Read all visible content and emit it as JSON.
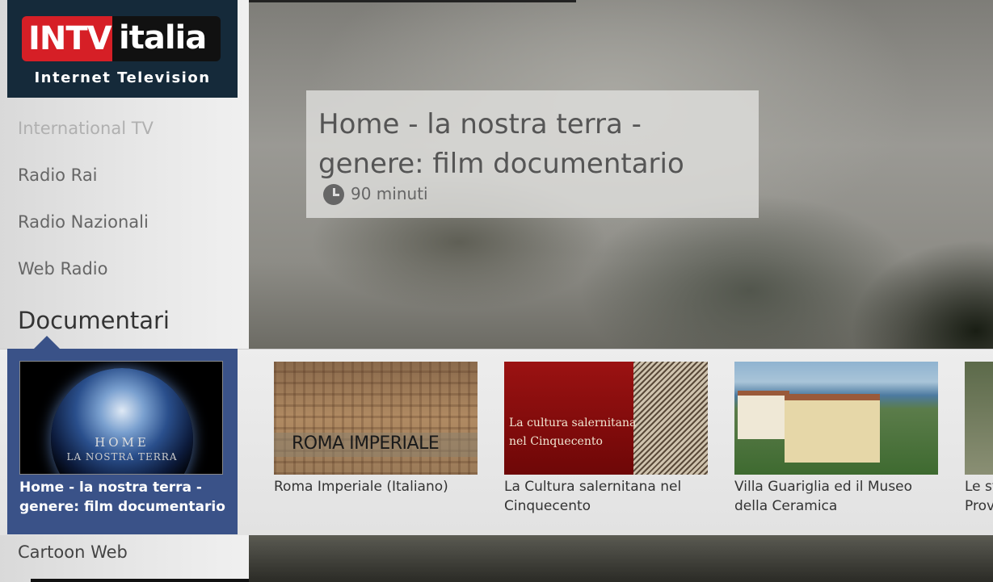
{
  "logo": {
    "brand_left": "INTV",
    "brand_right": "italia",
    "tagline": "Internet Television"
  },
  "sidebar": {
    "items": [
      {
        "label": "International TV"
      },
      {
        "label": "Radio Rai"
      },
      {
        "label": "Radio Nazionali"
      },
      {
        "label": "Web Radio"
      }
    ],
    "active_category": "Documentari",
    "next_category": "Cartoon Web"
  },
  "featured": {
    "title": "Home - la nostra terra - genere: film documentario",
    "duration": "90 minuti"
  },
  "carousel": {
    "selected": {
      "title": "Home - la nostra terra - genere: film documentario",
      "thumb_line1": "HOME",
      "thumb_line2": "LA NOSTRA TERRA"
    },
    "items": [
      {
        "title": "Roma Imperiale (Italiano)",
        "thumb_text": "ROMA IMPERIALE"
      },
      {
        "title": "La Cultura salernitana nel Cinquecento",
        "thumb_line1": "La cultura salernitana",
        "thumb_line2": "nel Cinquecento"
      },
      {
        "title": "Villa Guariglia ed il Museo della Ceramica"
      },
      {
        "title": "Le st\nProv"
      }
    ]
  }
}
